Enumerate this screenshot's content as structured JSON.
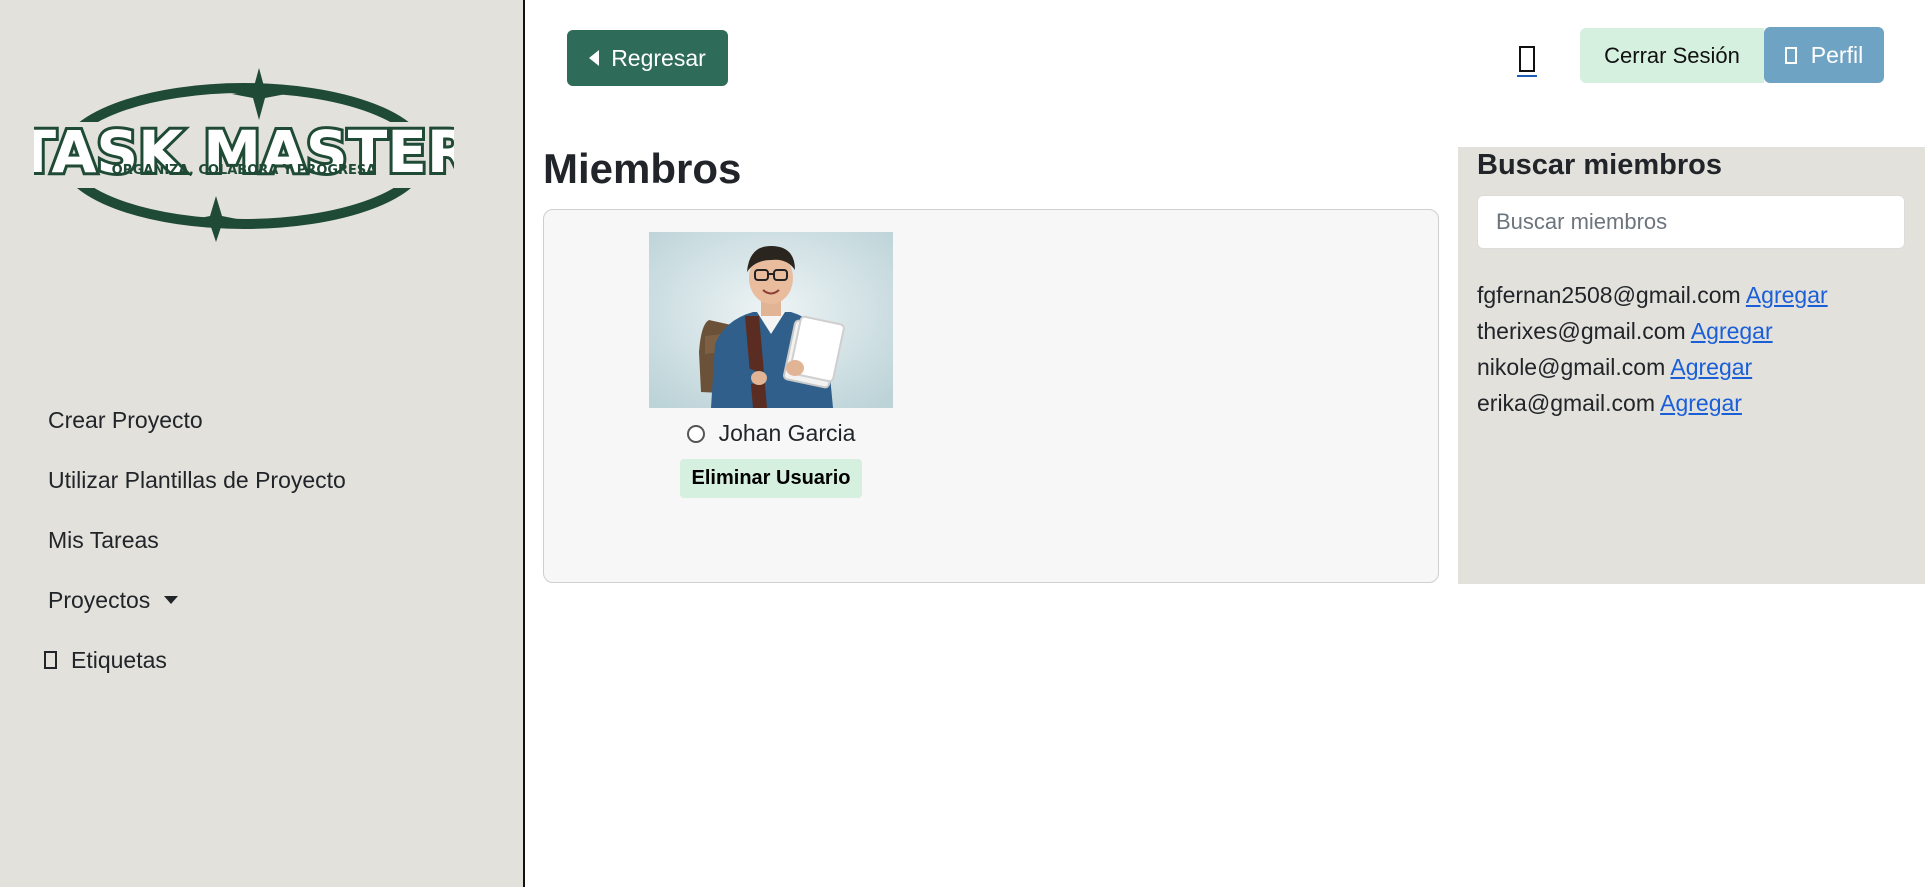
{
  "logo": {
    "title": "TASK MASTER",
    "tagline": "ORGANIZA, COLABORA Y PROGRESA"
  },
  "sidebar": {
    "items": [
      {
        "label": "Crear Proyecto"
      },
      {
        "label": "Utilizar Plantillas de Proyecto"
      },
      {
        "label": "Mis Tareas"
      },
      {
        "label": "Proyectos"
      },
      {
        "label": "Etiquetas"
      }
    ]
  },
  "header": {
    "back_label": "Regresar",
    "logout_label": "Cerrar Sesión",
    "profile_label": "Perfil"
  },
  "members": {
    "title": "Miembros",
    "list": [
      {
        "name": "Johan Garcia",
        "remove_label": "Eliminar Usuario"
      }
    ]
  },
  "search": {
    "title": "Buscar miembros",
    "placeholder": "Buscar miembros",
    "add_label": "Agregar",
    "results": [
      {
        "email": "fgfernan2508@gmail.com"
      },
      {
        "email": "therixes@gmail.com"
      },
      {
        "email": "nikole@gmail.com"
      },
      {
        "email": "erika@gmail.com"
      }
    ]
  },
  "colors": {
    "sidebar_bg": "#e3e1dc",
    "back_button": "#2e6b58",
    "logout_button": "#d6f0e0",
    "profile_button": "#6fa3c4",
    "logo_green": "#1f4a35",
    "link": "#1a5fd8"
  }
}
